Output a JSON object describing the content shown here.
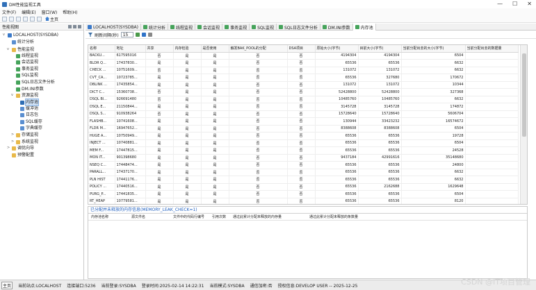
{
  "window": {
    "title": "DM性能监视工具",
    "controls": [
      "—",
      "☐",
      "✕"
    ]
  },
  "menu": [
    "文件(F)",
    "编辑(E)",
    "窗口(W)",
    "帮助(H)"
  ],
  "toolbar": {
    "home_label": "主页"
  },
  "left_panel": {
    "title": "性能视图",
    "tree": [
      {
        "label": "LOCALHOST(SYSDBA)",
        "level": 0,
        "icon": "db",
        "twisty": "v"
      },
      {
        "label": "统计分析",
        "level": 1,
        "icon": "leaf",
        "twisty": ""
      },
      {
        "label": "性能监视",
        "level": 1,
        "icon": "folder",
        "twisty": "v"
      },
      {
        "label": "线程监视",
        "level": 2,
        "icon": "mon",
        "twisty": ""
      },
      {
        "label": "会话监视",
        "level": 2,
        "icon": "mon",
        "twisty": ""
      },
      {
        "label": "事务监视",
        "level": 2,
        "icon": "mon",
        "twisty": ""
      },
      {
        "label": "SQL监视",
        "level": 2,
        "icon": "mon",
        "twisty": ""
      },
      {
        "label": "SQL日志文件分析",
        "level": 2,
        "icon": "mon",
        "twisty": ""
      },
      {
        "label": "DM.INI参数",
        "level": 2,
        "icon": "mon",
        "twisty": ""
      },
      {
        "label": "资源监视",
        "level": 2,
        "icon": "folder",
        "twisty": "v"
      },
      {
        "label": "内存池",
        "level": 3,
        "icon": "sel",
        "twisty": "",
        "selected": true
      },
      {
        "label": "缓冲池",
        "level": 3,
        "icon": "leaf",
        "twisty": ""
      },
      {
        "label": "日志包",
        "level": 3,
        "icon": "leaf",
        "twisty": ""
      },
      {
        "label": "SQL缓存",
        "level": 3,
        "icon": "leaf",
        "twisty": ""
      },
      {
        "label": "字典缓存",
        "level": 3,
        "icon": "leaf",
        "twisty": ""
      },
      {
        "label": "存储监视",
        "level": 2,
        "icon": "folder",
        "twisty": ">"
      },
      {
        "label": "系统监视",
        "level": 2,
        "icon": "folder",
        "twisty": ">"
      },
      {
        "label": "调优向导",
        "level": 1,
        "icon": "folder",
        "twisty": ">"
      },
      {
        "label": "预警配置",
        "level": 1,
        "icon": "folder",
        "twisty": ""
      }
    ]
  },
  "tabs": [
    {
      "label": "LOCALHOST(SYSDBA)",
      "active": false
    },
    {
      "label": "统计分析",
      "active": false
    },
    {
      "label": "线程监视",
      "active": false
    },
    {
      "label": "会话监视",
      "active": false
    },
    {
      "label": "事务监视",
      "active": false
    },
    {
      "label": "SQL监视",
      "active": false
    },
    {
      "label": "SQL日志文件分析",
      "active": false
    },
    {
      "label": "DM.INI参数",
      "active": false
    },
    {
      "label": "内存池",
      "active": true
    }
  ],
  "sub_toolbar": {
    "refresh_label": "刷新间隔(秒)",
    "interval_value": "15"
  },
  "pool_table": {
    "columns": [
      "名称",
      "地址",
      "共享",
      "内存检验",
      "是否使用",
      "触发BAK_POOL的分配",
      "DSA项目",
      "原始大小(字节)",
      "目前大小(字节)",
      "当前分配出去的大小(字节)",
      "当前分配出去的数据量"
    ],
    "rows": [
      [
        "BACKU...",
        "617595016",
        "否",
        "是",
        "是",
        "否",
        "否",
        "4194304",
        "4194304",
        "6504",
        ""
      ],
      [
        "BLDR Q...",
        "17437830...",
        "是",
        "是",
        "是",
        "否",
        "否",
        "65536",
        "65536",
        "6632",
        ""
      ],
      [
        "CHECK ...",
        "10751609...",
        "否",
        "是",
        "是",
        "否",
        "否",
        "131072",
        "131072",
        "6632",
        ""
      ],
      [
        "CVT_CA...",
        "10723785...",
        "是",
        "是",
        "是",
        "否",
        "否",
        "65536",
        "327680",
        "170672",
        ""
      ],
      [
        "DBLINK ...",
        "17435854...",
        "是",
        "是",
        "是",
        "否",
        "否",
        "131072",
        "131072",
        "10344",
        ""
      ],
      [
        "DICT C...",
        "15360738...",
        "否",
        "是",
        "是",
        "否",
        "否",
        "52428800",
        "52428800",
        "327368",
        ""
      ],
      [
        "DSQL Bl...",
        "926691480",
        "否",
        "是",
        "是",
        "否",
        "否",
        "10485760",
        "10485760",
        "6632",
        ""
      ],
      [
        "DSQL E...",
        "21150844...",
        "是",
        "是",
        "是",
        "否",
        "否",
        "3145728",
        "3145728",
        "174872",
        ""
      ],
      [
        "DSQL S...",
        "910938264",
        "否",
        "是",
        "是",
        "否",
        "否",
        "15728640",
        "15728640",
        "5606704",
        ""
      ],
      [
        "FLASHB...",
        "10741608...",
        "是",
        "是",
        "是",
        "否",
        "否",
        "130944",
        "33423232",
        "16574672",
        ""
      ],
      [
        "FLDR M...",
        "16947652...",
        "是",
        "是",
        "是",
        "否",
        "否",
        "8388608",
        "8388608",
        "6504",
        ""
      ],
      [
        "HUGE A...",
        "10750949...",
        "是",
        "是",
        "是",
        "否",
        "否",
        "65536",
        "65536",
        "19728",
        ""
      ],
      [
        "INJECT ...",
        "10740881...",
        "是",
        "是",
        "是",
        "否",
        "否",
        "65536",
        "65536",
        "6504",
        ""
      ],
      [
        "MEM F...",
        "17447815...",
        "是",
        "是",
        "是",
        "否",
        "否",
        "65536",
        "65536",
        "24528",
        ""
      ],
      [
        "MON IT...",
        "901398680",
        "是",
        "是",
        "是",
        "否",
        "否",
        "9437184",
        "42991616",
        "35148680",
        ""
      ],
      [
        "NSEQ C...",
        "17448474...",
        "是",
        "是",
        "是",
        "否",
        "否",
        "65536",
        "65536",
        "24800",
        ""
      ],
      [
        "PARALL...",
        "17437170...",
        "是",
        "是",
        "是",
        "否",
        "否",
        "65536",
        "65536",
        "6632",
        ""
      ],
      [
        "PLN HIST",
        "17441176...",
        "是",
        "是",
        "是",
        "否",
        "否",
        "65536",
        "65536",
        "6632",
        ""
      ],
      [
        "POLICY ...",
        "17440516...",
        "是",
        "是",
        "是",
        "否",
        "否",
        "65536",
        "2162688",
        "1629648",
        ""
      ],
      [
        "PURG_P...",
        "17441835...",
        "是",
        "是",
        "是",
        "否",
        "否",
        "65536",
        "65536",
        "6504",
        ""
      ],
      [
        "RT_HEAP",
        "10779581...",
        "是",
        "是",
        "是",
        "否",
        "否",
        "65536",
        "65536",
        "8120",
        ""
      ],
      [
        "RT_HEAP",
        "10782220...",
        "是",
        "是",
        "是",
        "否",
        "否",
        "65536",
        "65536",
        "8288",
        ""
      ]
    ]
  },
  "leak_section": {
    "title": "已分配并未释放的内存信息(MEMORY_LEAK_CHECK=1)",
    "columns": [
      "内存池名称",
      "源文件名",
      "文件中的代码行编号",
      "引用次数",
      "通过此累计分配未释放的内存量",
      "通过此累计分配未释放的条数量"
    ]
  },
  "status_bar": {
    "prefix": "主页",
    "items": [
      "当前站点:LOCALHOST",
      "连接端口:5236",
      "当前登录:SYSDBA",
      "登录时间:2025-02-14 14:22:31",
      "当前模式:SYSDBA",
      "通信加密:否",
      "授权信息:DEVELOP USER -- 2025-12-25"
    ]
  },
  "watermark": "CSDN @IT项目管理"
}
